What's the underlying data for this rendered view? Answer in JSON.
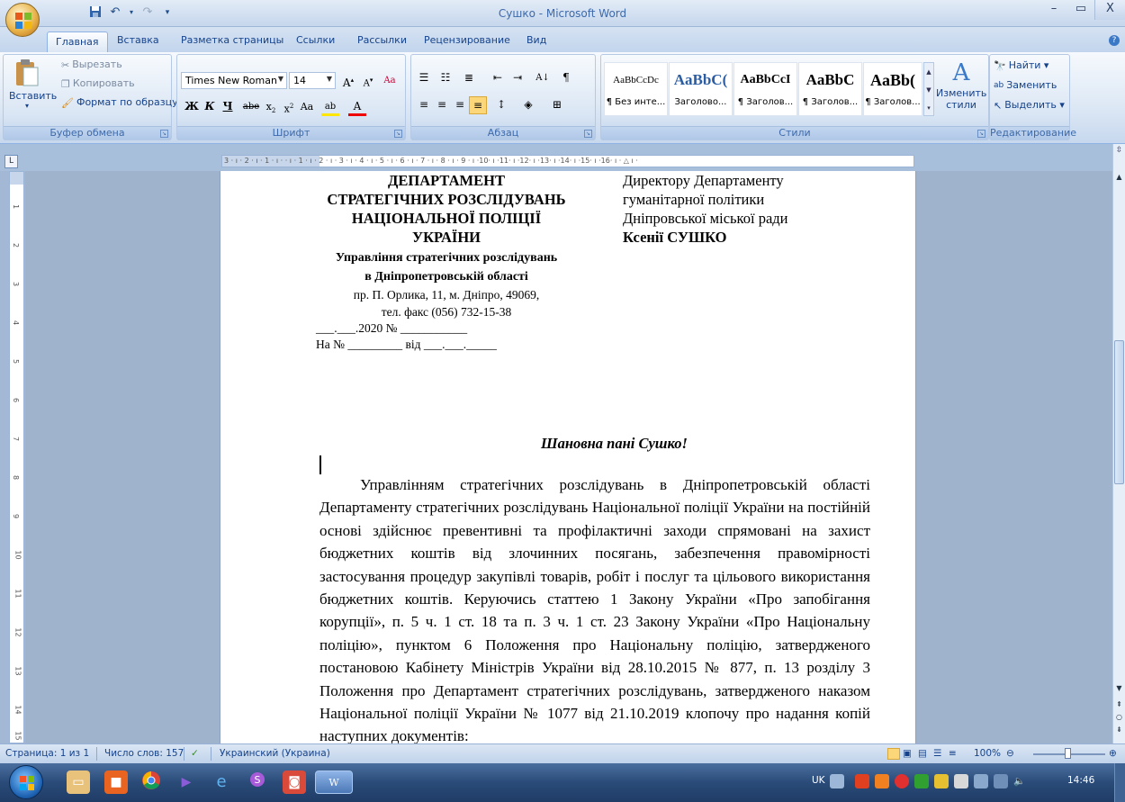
{
  "window": {
    "title": "Сушко - Microsoft Word",
    "controls": [
      "–",
      "▭",
      "X"
    ]
  },
  "tabs": [
    "Главная",
    "Вставка",
    "Разметка страницы",
    "Ссылки",
    "Рассылки",
    "Рецензирование",
    "Вид"
  ],
  "ribbon": {
    "clipboard": {
      "label": "Буфер обмена",
      "paste": "Вставить",
      "cut": "Вырезать",
      "copy": "Копировать",
      "format_painter": "Формат по образцу"
    },
    "font": {
      "label": "Шрифт",
      "family": "Times New Roman",
      "size": "14"
    },
    "paragraph": {
      "label": "Абзац"
    },
    "styles": {
      "label": "Стили",
      "items": [
        {
          "sample": "AaBbCcDc",
          "name": "¶ Без инте..."
        },
        {
          "sample": "AaBbC(",
          "name": "Заголово..."
        },
        {
          "sample": "AaBbCcI",
          "name": "¶ Заголов..."
        },
        {
          "sample": "AaBbC",
          "name": "¶ Заголов..."
        },
        {
          "sample": "AaBb(",
          "name": "¶ Заголов..."
        }
      ],
      "change_styles": "Изменить стили"
    },
    "editing": {
      "label": "Редактирование",
      "find": "Найти",
      "replace": "Заменить",
      "select": "Выделить"
    }
  },
  "ruler": {
    "text": "3 · ı · 2 · ı · 1 · ı ·  · ı · 1 · ı · 2 · ı · 3 · ı · 4 · ı · 5 · ı · 6 · ı · 7 · ı · 8 · ı · 9 · ı ·10· ı ·11· ı ·12· ı ·13· ı ·14· ı ·15· ı ·16· ı · △ ı ·",
    "vertical_ticks": [
      "1",
      "2",
      "3",
      "4",
      "5",
      "6",
      "7",
      "8",
      "9",
      "10",
      "11",
      "12",
      "13",
      "14",
      "15"
    ]
  },
  "document": {
    "sender": {
      "org_lines": [
        "ДЕПАРТАМЕНТ",
        "СТРАТЕГІЧНИХ РОЗСЛІДУВАНЬ",
        "НАЦІОНАЛЬНОЇ ПОЛІЦІЇ",
        "УКРАЇНИ"
      ],
      "dept_lines": [
        "Управління стратегічних розслідувань",
        "в Дніпропетровській області"
      ],
      "address": "пр. П. Орлика, 11, м. Дніпро, 49069,",
      "phone": "тел. факс (056) 732-15-38",
      "number_line": "___.___.2020     № ___________",
      "reply_line": "На № _________ від ___.___._____"
    },
    "recipient": {
      "lines": [
        "Директору Департаменту",
        "гуманітарної політики",
        "Дніпровської міської ради"
      ],
      "name": "Ксенії СУШКО"
    },
    "greeting": "Шановна пані Сушко!",
    "paragraph": "Управлінням стратегічних розслідувань в Дніпропетровській області Департаменту стратегічних розслідувань Національної поліції України на постійній основі здійснює превентивні та профілактичні заходи спрямовані на захист бюджетних коштів від злочинних посягань, забезпечення правомірності застосування процедур закупівлі товарів, робіт і послуг та цільового використання бюджетних коштів. Керуючись статтею 1 Закону України «Про запобігання корупції», п. 5 ч. 1 ст. 18 та п. 3 ч. 1 ст. 23 Закону України «Про Національну поліцію», пунктом 6 Положення про Національну поліцію, затвердженого постановою Кабінету Міністрів України від 28.10.2015 № 877, п. 13 розділу 3 Положення про Департамент стратегічних розслідувань, затвердженого наказом Національної поліції України № 1077 від 21.10.2019 клопочу про надання копій наступних документів:"
  },
  "statusbar": {
    "page": "Страница: 1 из 1",
    "words": "Число слов: 157",
    "language": "Украинский (Украина)",
    "zoom": "100%",
    "zoom_value": 100
  },
  "taskbar": {
    "tray": {
      "lang": "UK",
      "time": "14:46"
    }
  },
  "colors": {
    "ribbon_text": "#15428b",
    "taskbar": "#2a4b78",
    "document_text": "#000000"
  }
}
